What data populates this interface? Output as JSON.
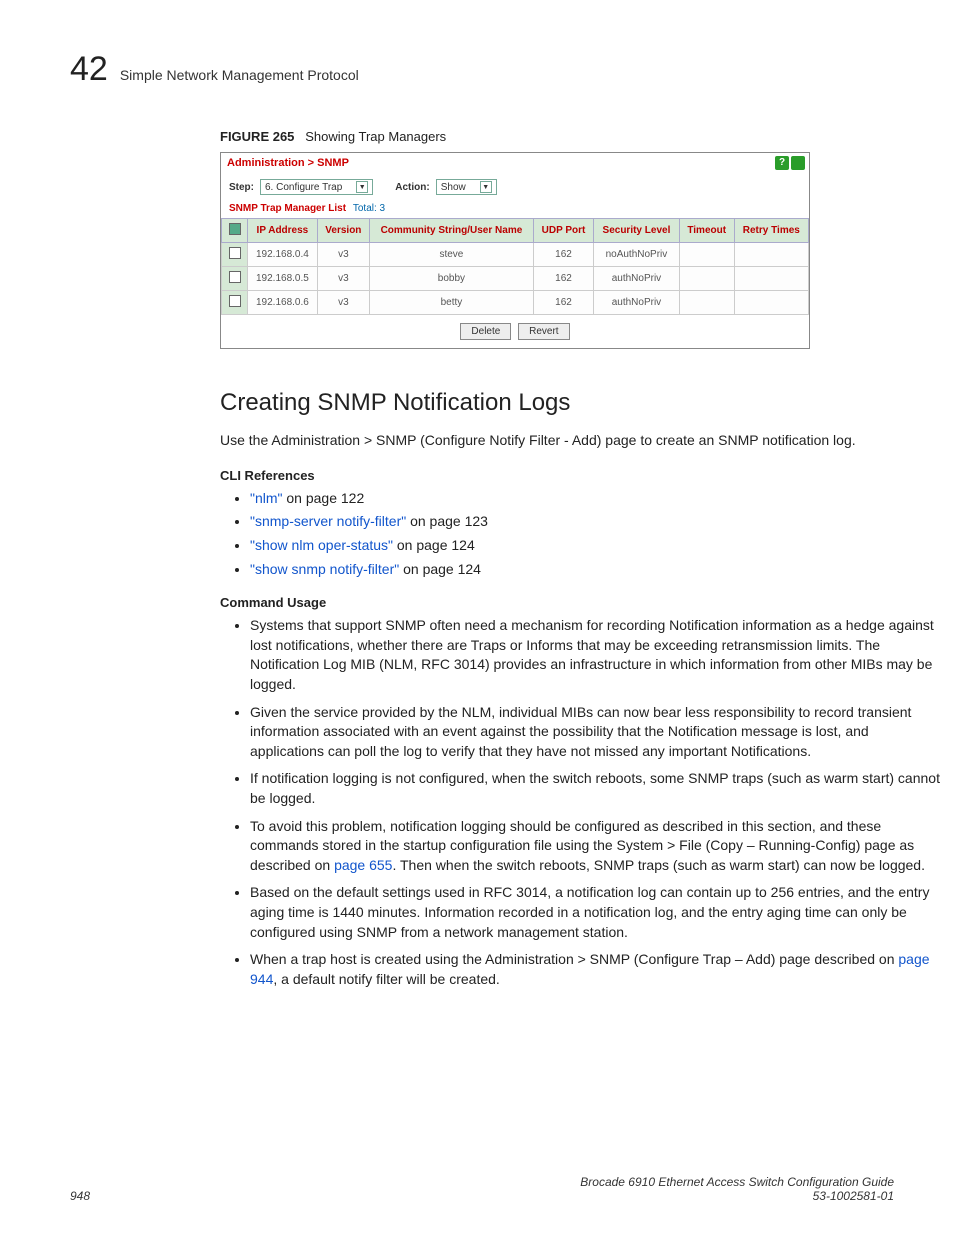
{
  "header": {
    "page_num_top": "42",
    "chapter_title": "Simple Network Management Protocol"
  },
  "figure": {
    "label": "FIGURE 265",
    "caption": "Showing Trap Managers"
  },
  "screenshot": {
    "breadcrumb": "Administration > SNMP",
    "help_icon": "?",
    "step_label": "Step:",
    "step_value": "6. Configure Trap",
    "action_label": "Action:",
    "action_value": "Show",
    "list_title": "SNMP Trap Manager List",
    "total_label": "Total: 3",
    "columns": [
      "IP Address",
      "Version",
      "Community String/User Name",
      "UDP Port",
      "Security Level",
      "Timeout",
      "Retry Times"
    ],
    "rows": [
      {
        "ip": "192.168.0.4",
        "ver": "v3",
        "user": "steve",
        "port": "162",
        "sec": "noAuthNoPriv",
        "timeout": "",
        "retry": ""
      },
      {
        "ip": "192.168.0.5",
        "ver": "v3",
        "user": "bobby",
        "port": "162",
        "sec": "authNoPriv",
        "timeout": "",
        "retry": ""
      },
      {
        "ip": "192.168.0.6",
        "ver": "v3",
        "user": "betty",
        "port": "162",
        "sec": "authNoPriv",
        "timeout": "",
        "retry": ""
      }
    ],
    "btn_delete": "Delete",
    "btn_revert": "Revert"
  },
  "section": {
    "heading": "Creating SNMP Notification Logs",
    "intro": "Use the Administration > SNMP (Configure Notify Filter - Add) page to create an SNMP notification log.",
    "cli_head": "CLI References",
    "cli_refs": [
      {
        "link": "\"nlm\"",
        "suffix": " on page 122"
      },
      {
        "link": "\"snmp-server notify-filter\"",
        "suffix": " on page 123"
      },
      {
        "link": "\"show nlm oper-status\"",
        "suffix": " on page 124"
      },
      {
        "link": "\"show snmp notify-filter\"",
        "suffix": " on page 124"
      }
    ],
    "usage_head": "Command Usage",
    "usage": {
      "b1": "Systems that support SNMP often need a mechanism for recording Notification information as a hedge against lost notifications, whether there are Traps or Informs that may be exceeding retransmission limits. The Notification Log MIB (NLM, RFC 3014) provides an infrastructure in which information from other MIBs may be logged.",
      "b2": "Given the service provided by the NLM, individual MIBs can now bear less responsibility to record transient information associated with an event against the possibility that the Notification message is lost, and applications can poll the log to verify that they have not missed any important Notifications.",
      "b3": "If notification logging is not configured, when the switch reboots, some SNMP traps (such as warm start) cannot be logged.",
      "b4_pre": "To avoid this problem, notification logging should be configured as described in this section, and these commands stored in the startup configuration file using the System > File (Copy – Running-Config) page as described on ",
      "b4_link": "page 655",
      "b4_post": ". Then when the switch reboots, SNMP traps (such as warm start) can now be logged.",
      "b5": "Based on the default settings used in RFC 3014, a notification log can contain up to 256 entries, and the entry aging time is 1440 minutes. Information recorded in a notification log, and the entry aging time can only be configured using SNMP from a network management station.",
      "b6_pre": "When a trap host is created using the Administration > SNMP (Configure Trap – Add) page described on ",
      "b6_link": "page 944",
      "b6_post": ", a default notify filter will be created."
    }
  },
  "footer": {
    "page": "948",
    "guide": "Brocade 6910 Ethernet Access Switch Configuration Guide",
    "docnum": "53-1002581-01"
  }
}
